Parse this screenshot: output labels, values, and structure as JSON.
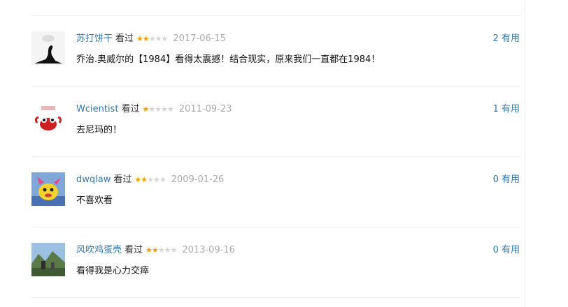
{
  "comments": [
    {
      "user": "苏打饼干",
      "action": "看过",
      "stars_filled": 2,
      "stars_total": 5,
      "date": "2017-06-15",
      "votes_count": "2",
      "votes_label": "有用",
      "content": "乔治.奥威尔的【1984】看得太震撼！结合现实，原来我们一直都在1984！",
      "avatar_icon": "black-swan-avatar"
    },
    {
      "user": "Wcientist",
      "action": "看过",
      "stars_filled": 1,
      "stars_total": 5,
      "date": "2011-09-23",
      "votes_count": "1",
      "votes_label": "有用",
      "content": "去尼玛的！",
      "avatar_icon": "red-crab-avatar"
    },
    {
      "user": "dwqlaw",
      "action": "看过",
      "stars_filled": 2,
      "stars_total": 5,
      "date": "2009-01-26",
      "votes_count": "0",
      "votes_label": "有用",
      "content": "不喜欢看",
      "avatar_icon": "cartoon-character-avatar"
    },
    {
      "user": "风吹鸡蛋壳",
      "action": "看过",
      "stars_filled": 2,
      "stars_total": 5,
      "date": "2013-09-16",
      "votes_count": "0",
      "votes_label": "有用",
      "content": "看得我是心力交瘁",
      "avatar_icon": "landscape-photo-avatar"
    }
  ],
  "colors": {
    "link": "#3377aa",
    "star_on": "#f0a000",
    "star_off": "#d4d4d4",
    "date": "#aaaaaa"
  }
}
